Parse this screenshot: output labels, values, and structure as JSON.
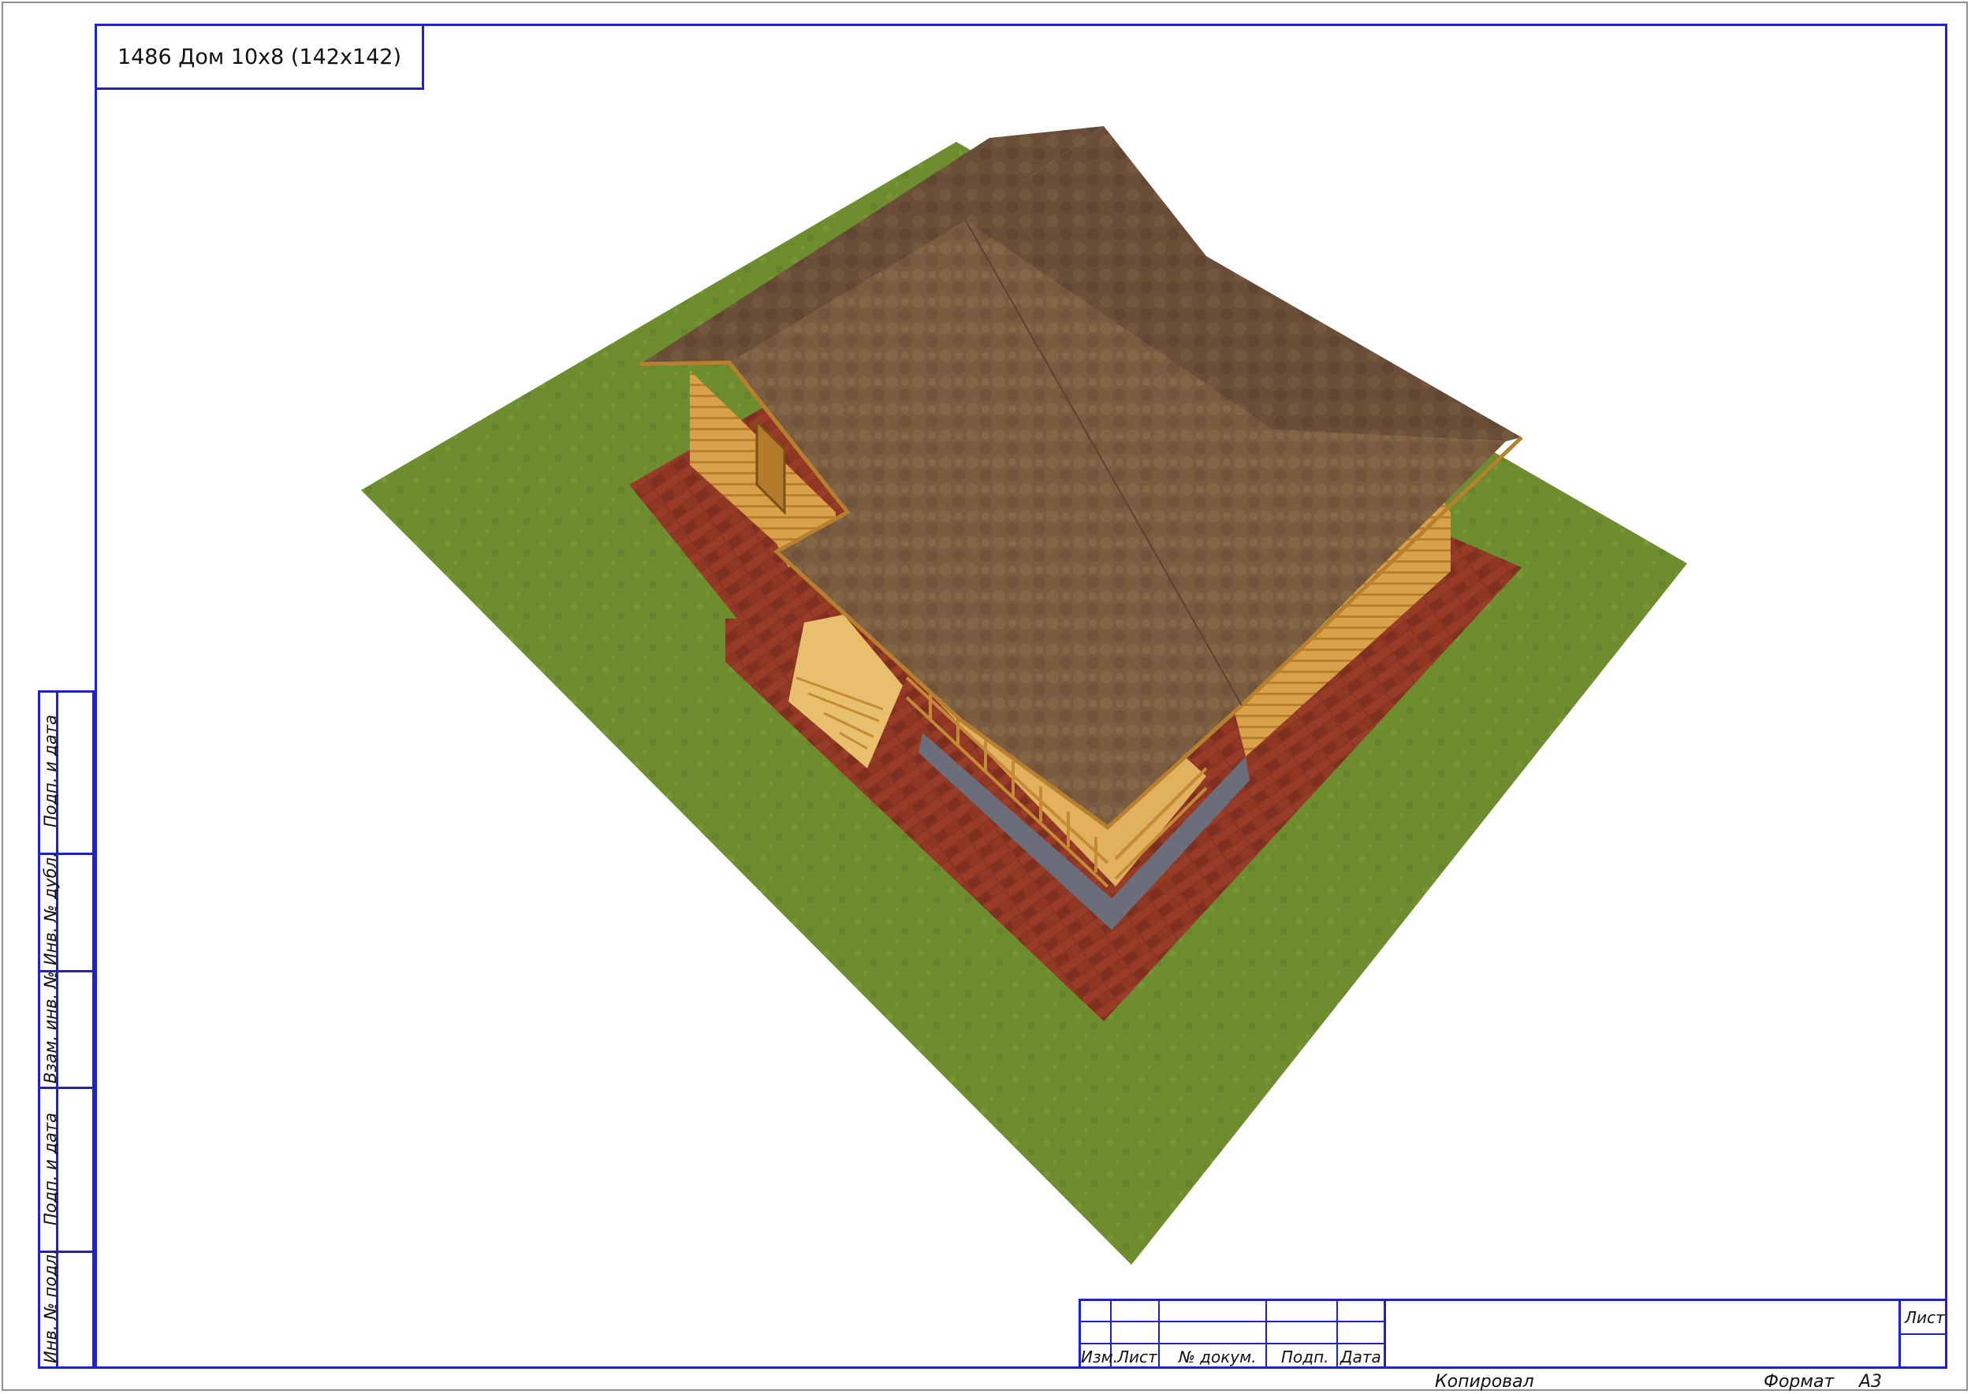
{
  "drawing": {
    "title": "1486 Дом 10x8 (142x142)"
  },
  "side_stamp": {
    "labels": [
      "Подп. и дата",
      "Инв. № дубл.",
      "Взам. инв. №",
      "Подп. и дата",
      "Инв. № подл."
    ]
  },
  "title_block": {
    "col_izm": "Изм.",
    "col_list": "Лист",
    "col_doc": "№ докум.",
    "col_sign": "Подп.",
    "col_date": "Дата",
    "sheet": "Лист"
  },
  "footer": {
    "copied": "Копировал",
    "format_label": "Формат",
    "format_value": "А3"
  },
  "colors": {
    "frame": "#1f22c8",
    "grass": "#6f8f2d",
    "paving": "#8a3524",
    "roof": "#7a5a3e",
    "timber": "#d9a24a"
  }
}
